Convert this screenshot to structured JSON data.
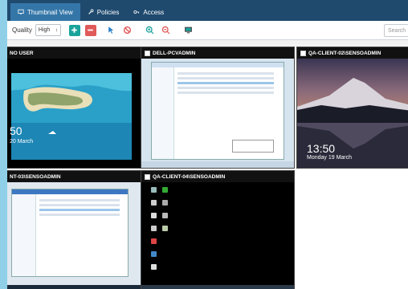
{
  "tabs": [
    {
      "label": "Thumbnail View",
      "icon": "monitor-icon",
      "active": true
    },
    {
      "label": "Policies",
      "icon": "wrench-icon",
      "active": false
    },
    {
      "label": "Access",
      "icon": "key-icon",
      "active": false
    }
  ],
  "toolbar": {
    "quality_label": "Quality",
    "quality_value": "High",
    "search_placeholder": "Search",
    "buttons": [
      "zoom-in-tile-button",
      "zoom-out-tile-button",
      "pointer-button",
      "block-button",
      "zoom-in-button",
      "zoom-out-button",
      "monitor-button"
    ]
  },
  "tiles": [
    {
      "title": "NO USER",
      "time": "50",
      "date": "20 March"
    },
    {
      "title": "DELL-PCVADMIN"
    },
    {
      "title": "QA-CLIENT-02\\SENSOADMIN",
      "time": "13:50",
      "date": "Monday 19 March"
    },
    {
      "title": "NT-03\\SENSOADMIN"
    },
    {
      "title": "QA-CLIENT-04\\SENSOADMIN"
    }
  ],
  "colors": {
    "tabbar": "#1f4a6e",
    "tab_active": "#3476a8",
    "teal_button": "#19a39b",
    "red_button": "#e05a5a",
    "accent": "#8fd0e8"
  }
}
